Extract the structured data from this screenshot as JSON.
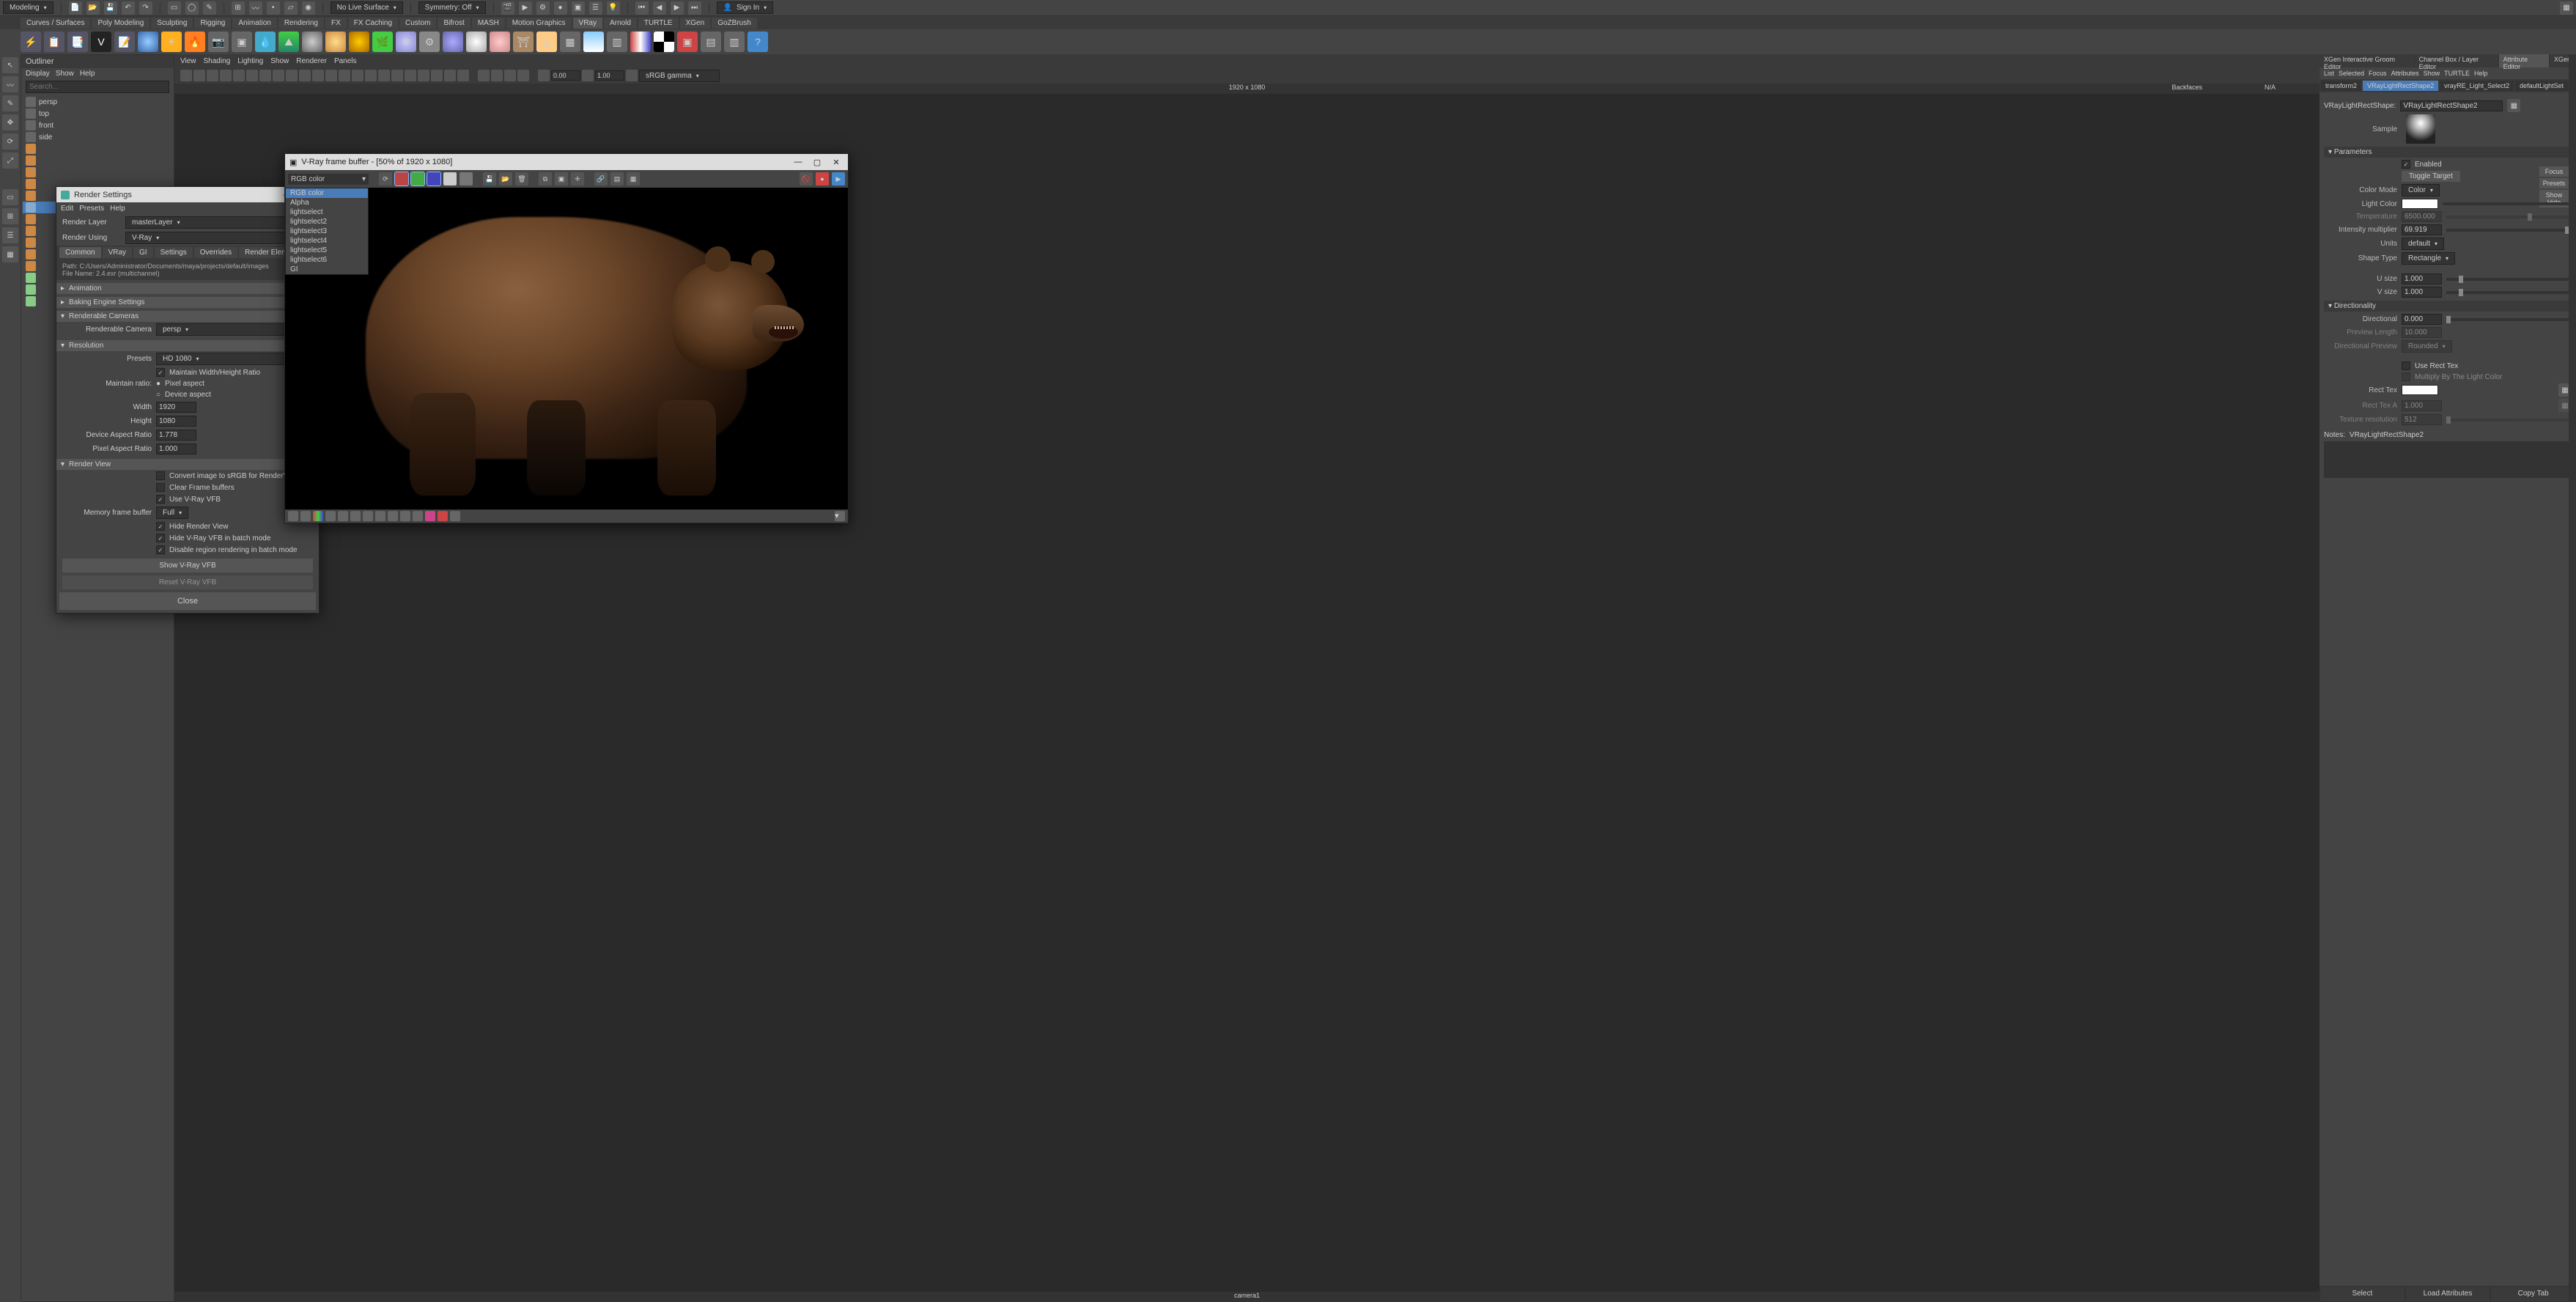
{
  "topbar": {
    "workspace": "Modeling",
    "noLiveSurface": "No Live Surface",
    "symmetry": "Symmetry: Off",
    "signIn": "Sign In"
  },
  "shelfTabs": [
    "Curves / Surfaces",
    "Poly Modeling",
    "Sculpting",
    "Rigging",
    "Animation",
    "Rendering",
    "FX",
    "FX Caching",
    "Custom",
    "Bifrost",
    "MASH",
    "Motion Graphics",
    "VRay",
    "Arnold",
    "TURTLE",
    "XGen",
    "GoZBrush"
  ],
  "activeShelf": "VRay",
  "outliner": {
    "title": "Outliner",
    "menus": [
      "Display",
      "Show",
      "Help"
    ],
    "searchPlaceholder": "Search...",
    "items": [
      "persp",
      "top",
      "front",
      "side"
    ]
  },
  "viewport": {
    "menus": [
      "View",
      "Shading",
      "Lighting",
      "Show",
      "Renderer",
      "Panels"
    ],
    "exposure": "0.00",
    "gamma": "1.00",
    "colorSpace": "sRGB gamma",
    "resInfo": "1920 x 1080",
    "infoRight1": "Backfaces",
    "infoRight2": "N/A",
    "bottomLabel": "camera1"
  },
  "renderSettings": {
    "title": "Render Settings",
    "menus": [
      "Edit",
      "Presets",
      "Help"
    ],
    "renderLayerLabel": "Render Layer",
    "renderLayer": "masterLayer",
    "renderUsingLabel": "Render Using",
    "renderUsing": "V-Ray",
    "tabs": [
      "Common",
      "VRay",
      "GI",
      "Settings",
      "Overrides",
      "Render Elements"
    ],
    "activeTab": "Common",
    "pathLabel": "Path:",
    "path": "C:/Users/Administrator/Documents/maya/projects/default/images",
    "fileNameLabel": "File Name:",
    "fileName": "2.4.exr (multichannel)",
    "sections": {
      "animation": "Animation",
      "baking": "Baking Engine Settings",
      "cameras": "Renderable Cameras",
      "resolution": "Resolution",
      "renderView": "Render View"
    },
    "renderableCameraLabel": "Renderable Camera",
    "renderableCamera": "persp",
    "presetsLabel": "Presets",
    "presets": "HD 1080",
    "maintainRatio": "Maintain Width/Height Ratio",
    "maintainRatioLabel": "Maintain ratio:",
    "pixelAspect": "Pixel aspect",
    "deviceAspect": "Device aspect",
    "widthLabel": "Width",
    "width": "1920",
    "heightLabel": "Height",
    "height": "1080",
    "deviceAspectLabel": "Device Aspect Ratio",
    "deviceAspectVal": "1.778",
    "pixelAspectLabel": "Pixel Aspect Ratio",
    "pixelAspectVal": "1.000",
    "convertSRGB": "Convert image to sRGB for RenderView",
    "clearBuffers": "Clear Frame buffers",
    "useVFB": "Use V-Ray VFB",
    "memBufferLabel": "Memory frame buffer",
    "memBuffer": "Full",
    "hideRenderView": "Hide Render View",
    "hideVFBBatch": "Hide V-Ray VFB in batch mode",
    "disableRegion": "Disable region rendering in batch mode",
    "showVFB": "Show V-Ray VFB",
    "resetVFB": "Reset V-Ray VFB",
    "close": "Close"
  },
  "vfb": {
    "title": "V-Ray frame buffer - [50% of 1920 x 1080]",
    "channel": "RGB color",
    "channels": [
      "RGB color",
      "Alpha",
      "lightselect",
      "lightselect2",
      "lightselect3",
      "lightselect4",
      "lightselect5",
      "lightselect6",
      "GI"
    ]
  },
  "rightTop": {
    "tabs": [
      "XGen Interactive Groom Editor",
      "Channel Box / Layer Editor",
      "Attribute Editor",
      "XGen"
    ],
    "active": "Attribute Editor",
    "menus": [
      "List",
      "Selected",
      "Focus",
      "Attributes",
      "Show",
      "TURTLE",
      "Help"
    ],
    "nodeTabs": [
      "transform2",
      "VRayLightRectShape2",
      "vrayRE_Light_Select2",
      "defaultLightSet"
    ],
    "activeNode": "VRayLightRectShape2",
    "nodeTypeLabel": "VRayLightRectShape:",
    "nodeName": "VRayLightRectShape2",
    "focus": "Focus",
    "presets": "Presets",
    "showHide": "Show   Hide",
    "sampleLabel": "Sample"
  },
  "attrs": {
    "parameters": "Parameters",
    "enabled": "Enabled",
    "toggleTarget": "Toggle Target",
    "colorModeLabel": "Color Mode",
    "colorMode": "Color",
    "lightColorLabel": "Light Color",
    "temperatureLabel": "Temperature",
    "temperature": "6500.000",
    "intensityLabel": "Intensity multiplier",
    "intensity": "69.919",
    "unitsLabel": "Units",
    "units": "default",
    "shapeTypeLabel": "Shape Type",
    "shapeType": "Rectangle",
    "uSizeLabel": "U size",
    "uSize": "1.000",
    "vSizeLabel": "V size",
    "vSize": "1.000",
    "directionality": "Directionality",
    "directionalLabel": "Directional",
    "directional": "0.000",
    "previewLengthLabel": "Preview Length",
    "previewLength": "10.000",
    "dirPreviewLabel": "Directional Preview",
    "dirPreview": "Rounded",
    "useRectTex": "Use Rect Tex",
    "multiplyLight": "Multiply By The Light Color",
    "rectTexLabel": "Rect Tex",
    "rectTexALabel": "Rect Tex A",
    "rectTexA": "1.000",
    "texResLabel": "Texture resolution",
    "texRes": "512",
    "notesLabel": "Notes:",
    "notesNode": "VRayLightRectShape2",
    "select": "Select",
    "loadAttrs": "Load Attributes",
    "copyTab": "Copy Tab"
  }
}
